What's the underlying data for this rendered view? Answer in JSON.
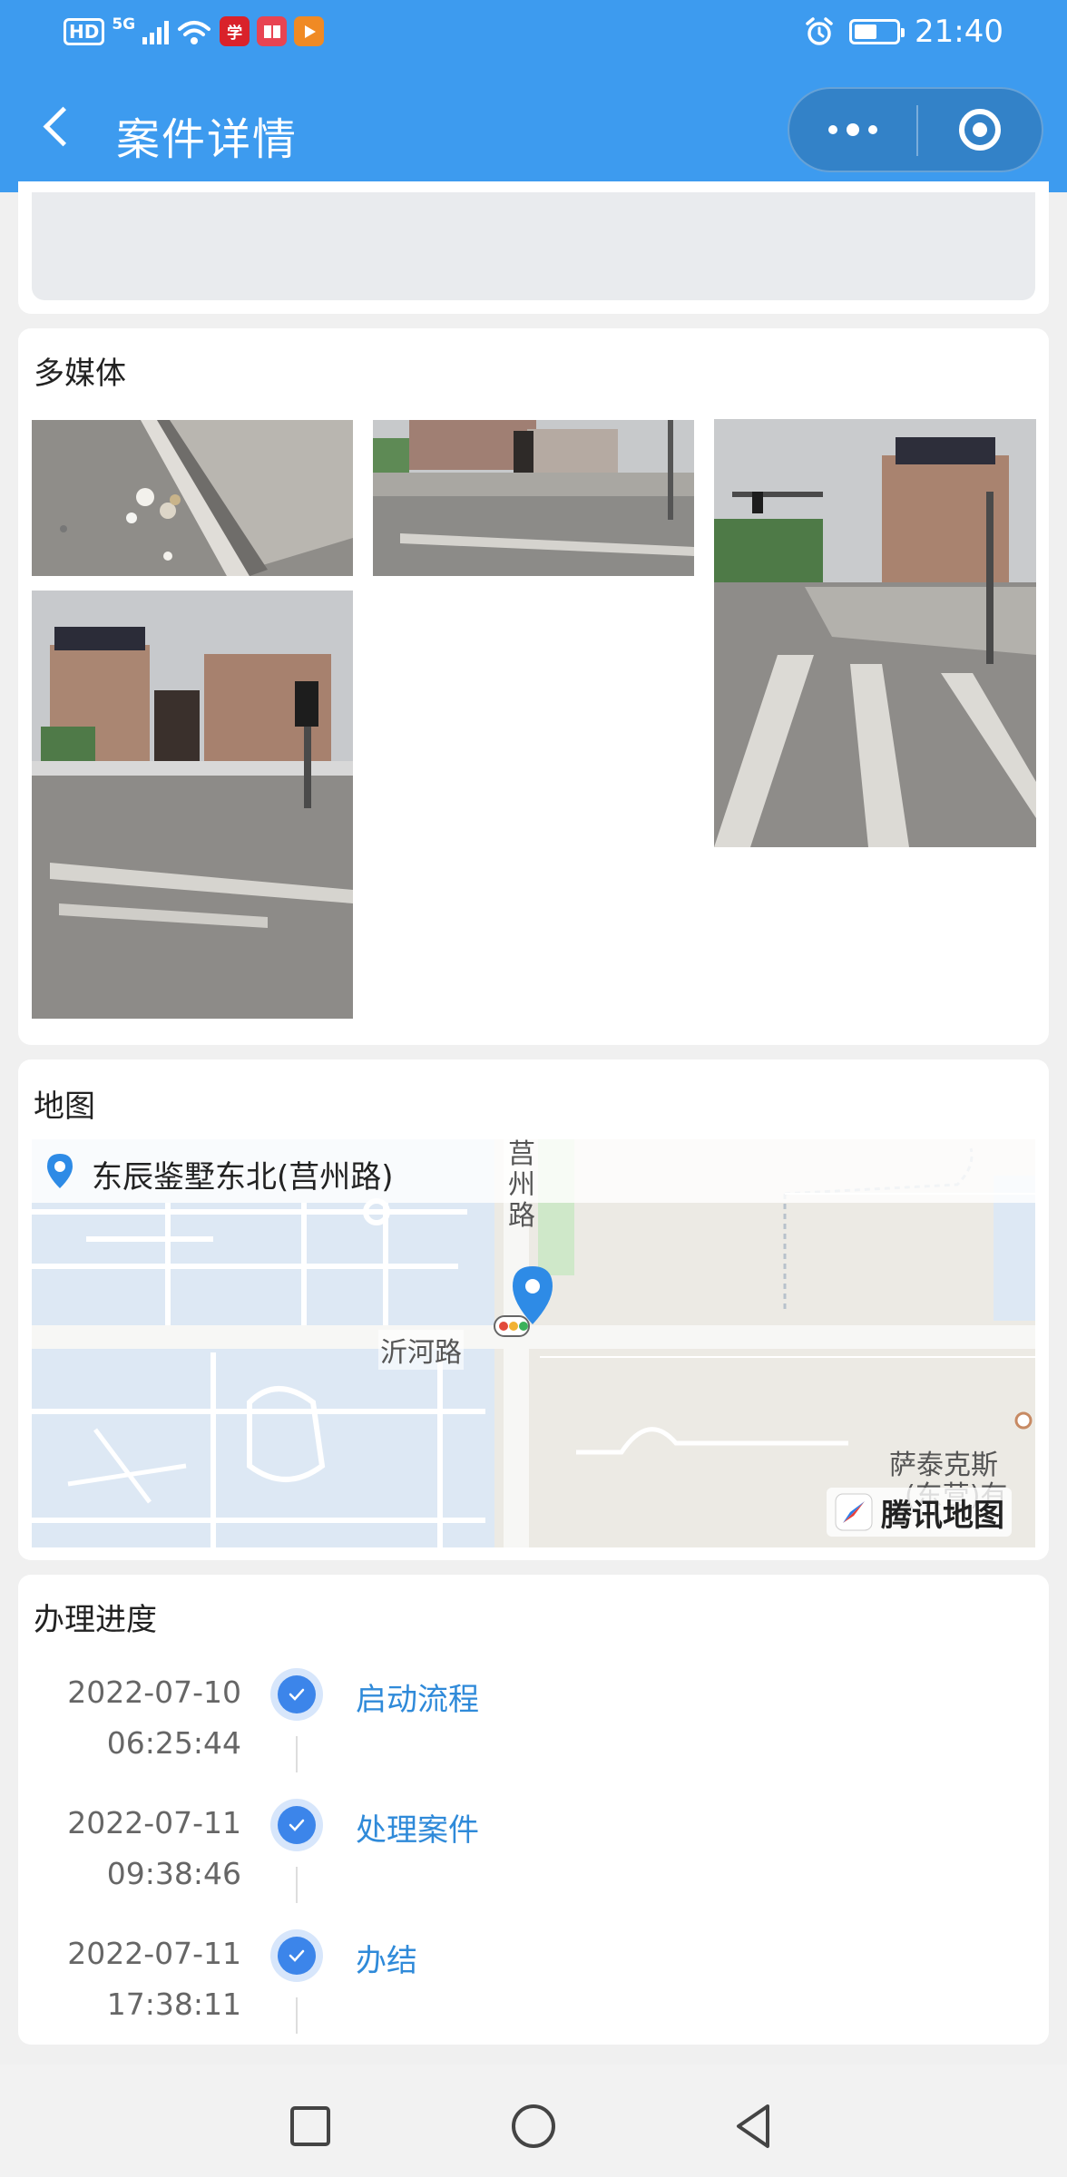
{
  "status_bar": {
    "hd": "HD",
    "network": "5G",
    "time": "21:40",
    "battery_level": 0.55
  },
  "nav": {
    "title": "案件详情"
  },
  "media": {
    "title": "多媒体"
  },
  "map": {
    "title": "地图",
    "address": "东辰鉴墅东北(莒州路)",
    "labels": {
      "road_vertical": "莒州路",
      "road_horizontal": "沂河路",
      "place": "萨泰克斯",
      "place_sub": "(东营)有",
      "provider": "腾讯地图"
    }
  },
  "progress": {
    "title": "办理进度",
    "steps": [
      {
        "date": "2022-07-10",
        "time": "06:25:44",
        "label": "启动流程"
      },
      {
        "date": "2022-07-11",
        "time": "09:38:46",
        "label": "处理案件"
      },
      {
        "date": "2022-07-11",
        "time": "17:38:11",
        "label": "办结"
      }
    ]
  },
  "colors": {
    "brand": "#3d9bef",
    "link": "#2f8ad9",
    "check": "#3c85ea"
  }
}
